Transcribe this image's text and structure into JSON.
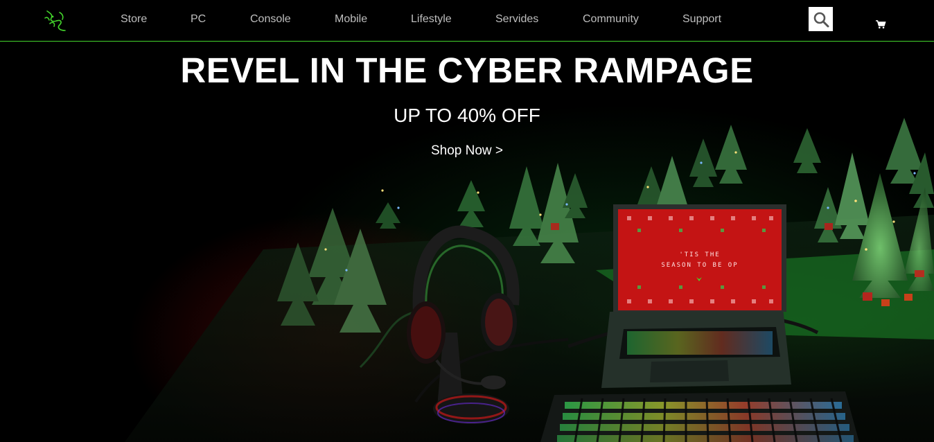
{
  "brand": {
    "logo_icon": "razer-snake-logo-icon",
    "accent_color": "#44d62c"
  },
  "nav": {
    "items": [
      {
        "label": "Store"
      },
      {
        "label": "PC"
      },
      {
        "label": "Console"
      },
      {
        "label": "Mobile"
      },
      {
        "label": "Lifestyle"
      },
      {
        "label": "Servides"
      },
      {
        "label": "Community"
      },
      {
        "label": "Support"
      }
    ],
    "search_icon": "search-icon",
    "cart_icon": "cart-icon"
  },
  "hero": {
    "title": "REVEL IN THE CYBER RAMPAGE",
    "subtitle": "UP TO 40% OFF",
    "cta_label": "Shop Now >",
    "screen_text_line1": "'TIS THE",
    "screen_text_line2": "SEASON TO BE OP"
  }
}
